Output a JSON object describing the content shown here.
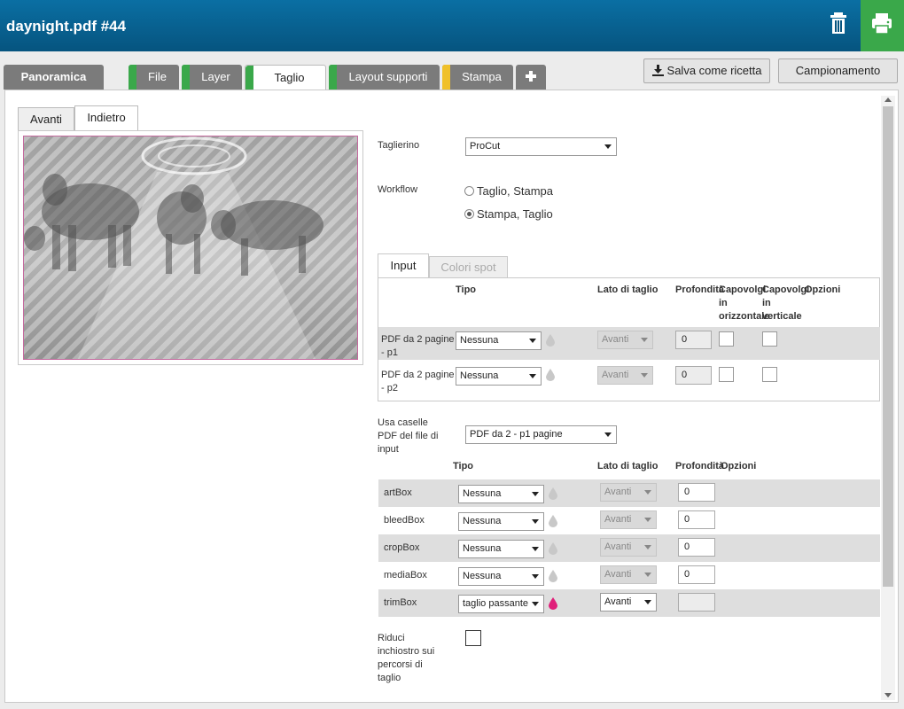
{
  "header": {
    "title": "daynight.pdf #44",
    "trash_icon": "trash-icon",
    "print_icon": "printer-icon"
  },
  "tabs": [
    {
      "label": "Panoramica",
      "strip": ""
    },
    {
      "label": "File",
      "strip": "#3aa84a"
    },
    {
      "label": "Layer",
      "strip": "#3aa84a"
    },
    {
      "label": "Taglio",
      "strip": "#3aa84a"
    },
    {
      "label": "Layout supporti",
      "strip": "#3aa84a"
    },
    {
      "label": "Stampa",
      "strip": "#f0c02a"
    }
  ],
  "add_tab_icon": "plus-icon",
  "actions": {
    "save_recipe": "Salva come ricetta",
    "sampling": "Campionamento"
  },
  "preview": {
    "tab_front": "Avanti",
    "tab_back": "Indietro"
  },
  "form": {
    "cutter_label": "Taglierino",
    "cutter_value": "ProCut",
    "workflow_label": "Workflow",
    "workflow_opt1": "Taglio, Stampa",
    "workflow_opt2": "Stampa, Taglio",
    "workflow_selected": "Stampa, Taglio"
  },
  "inner_tabs": {
    "input": "Input",
    "spot": "Colori spot"
  },
  "input_table": {
    "h_type": "Tipo",
    "h_side": "Lato di taglio",
    "h_depth": "Profondità",
    "h_flip_h1": "Capovolgi",
    "h_flip_h2": "in",
    "h_flip_h3": "orizzontale",
    "h_flip_v1": "Capovolgi",
    "h_flip_v2": "in",
    "h_flip_v3": "verticale",
    "h_options": "Opzioni",
    "rows": [
      {
        "name1": "PDF da 2 pagine",
        "name2": "- p1",
        "type": "Nessuna",
        "side": "Avanti",
        "depth": "0"
      },
      {
        "name1": "PDF da 2 pagine",
        "name2": "- p2",
        "type": "Nessuna",
        "side": "Avanti",
        "depth": "0"
      }
    ]
  },
  "boxes": {
    "label1": "Usa caselle",
    "label2": "PDF del file di",
    "label3": "input",
    "source_value": "PDF da 2 - p1 pagine",
    "h_type": "Tipo",
    "h_side": "Lato di taglio",
    "h_depth": "Profondità",
    "h_options": "Opzioni",
    "rows": [
      {
        "name": "artBox",
        "type": "Nessuna",
        "side": "Avanti",
        "depth": "0",
        "enabled": false
      },
      {
        "name": "bleedBox",
        "type": "Nessuna",
        "side": "Avanti",
        "depth": "0",
        "enabled": false
      },
      {
        "name": "cropBox",
        "type": "Nessuna",
        "side": "Avanti",
        "depth": "0",
        "enabled": false
      },
      {
        "name": "mediaBox",
        "type": "Nessuna",
        "side": "Avanti",
        "depth": "0",
        "enabled": false
      },
      {
        "name": "trimBox",
        "type": "taglio passante",
        "side": "Avanti",
        "depth": "",
        "enabled": true
      }
    ]
  },
  "reduce_ink": {
    "l1": "Riduci",
    "l2": "inchiostro sui",
    "l3": "percorsi di",
    "l4": "taglio"
  },
  "colors": {
    "header_top": "#0a6fa3",
    "print_green": "#3aa84a",
    "tab_grey": "#7b7b7b",
    "ink_magenta": "#e0207a"
  }
}
